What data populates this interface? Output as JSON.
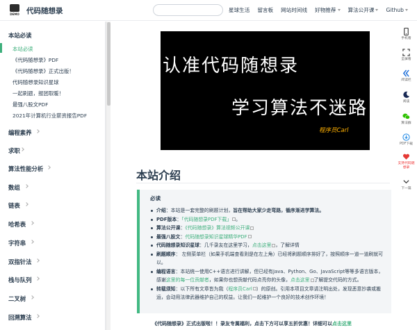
{
  "navbar": {
    "logo_text": "DEMO",
    "site_name": "代码随想录",
    "links": [
      {
        "label": "星球生活",
        "dropdown": false
      },
      {
        "label": "留言板",
        "dropdown": false
      },
      {
        "label": "网站时间线",
        "dropdown": false
      },
      {
        "label": "好物推荐",
        "dropdown": true
      },
      {
        "label": "算法公开课",
        "dropdown": true
      },
      {
        "label": "Github",
        "dropdown": true
      }
    ]
  },
  "sidebar": {
    "section_title": "本站必读",
    "sub_items": [
      {
        "label": "本站必读",
        "active": true
      },
      {
        "label": "《代码随想录》PDF",
        "active": false
      },
      {
        "label": "《代码随想录》正式出版！",
        "active": false
      },
      {
        "label": "代码随想录知识星球",
        "active": false
      },
      {
        "label": "一起刷题，报团取暖！",
        "active": false
      },
      {
        "label": "最强八股文PDF",
        "active": false
      },
      {
        "label": "2021年计算机行业薪资报告PDF",
        "active": false
      }
    ],
    "groups": [
      "编程素养",
      "求职",
      "算法性能分析",
      "数组",
      "链表",
      "哈希表",
      "字符串",
      "双指针法",
      "栈与队列",
      "二叉树",
      "回溯算法"
    ]
  },
  "banner": {
    "line1": "认准代码随想录",
    "line2": "学习算法不迷路",
    "signature": "程序员Carl"
  },
  "main": {
    "title": "本站介绍",
    "tip_title": "必读",
    "items": [
      {
        "label": "介绍",
        "text": "：本站是一套完整的刷题计划，",
        "bold": "旨在帮助大家少走弯路，循序渐进学算法。"
      },
      {
        "label": "PDF版本",
        "text": "：",
        "link": "「代码随想录PDF下载」",
        "tail": "。"
      },
      {
        "label": "算法公开课",
        "text": "：",
        "link": "《代码随想录》算法视频公开课",
        "tail": ""
      },
      {
        "label": "最强八股文",
        "text": "：",
        "link": "代码随想录知识星球精华PDF",
        "tail": ""
      },
      {
        "label": "代码随想录知识星球",
        "text": "：几千录友在这里学习，",
        "link": "点击这里",
        "tail": "，了解详情"
      },
      {
        "label": "刷题顺序",
        "text": "： 左侧菜单栏（如果手机端查看则是在左上角）已经将刷题顺序排好了，按照顺序一道一道刷就可以。"
      },
      {
        "label": "编程语言",
        "text": "：本站统一使用C++语言进行讲解，但已经有Java、Python、Go、JavaScript等等多语言版本，感谢",
        "link": "这里的每一位贡献者",
        "tail": "，如果你也想贡献代码点亮你的头像，",
        "link2": "点击这里",
        "tail2": "了解提交代码的方式。"
      },
      {
        "label": "转载须知",
        "text": "：以下所有文章皆为我（",
        "link": "程序员Carl",
        "tail": "）的原创。引用本项目文章请注明出处，发现恶意抄袭或搬运，会动用法律武器维护自己的权益。让我们一起维护一个良好的技术创作环境！"
      }
    ],
    "bottom_text": "《代码随想录》正式出版啦！！录友专属福利，点击下方可以享五折优惠！详细可以",
    "bottom_link": "点击这里"
  },
  "toolbar": {
    "items": [
      {
        "icon": "phone-icon",
        "label": "手机看"
      },
      {
        "icon": "expand-icon",
        "label": "全屏看"
      },
      {
        "icon": "double-chevron-icon",
        "label": "阅读栏"
      },
      {
        "icon": "moon-icon",
        "label": "阅读"
      },
      {
        "icon": "wechat-icon",
        "label": "算法群"
      },
      {
        "icon": "download-icon",
        "label": "PDF下载"
      },
      {
        "icon": "heart-icon",
        "label": "支持代码随想录"
      },
      {
        "icon": "arrow-down-icon",
        "label": "下一篇"
      }
    ]
  },
  "colors": {
    "accent": "#3eaf7c",
    "tip_border": "#42b983",
    "text": "#2c3e50"
  }
}
